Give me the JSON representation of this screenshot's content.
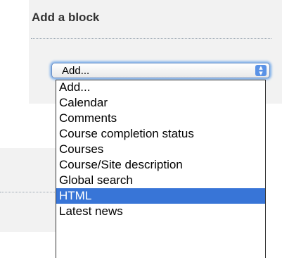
{
  "block": {
    "title": "Add a block"
  },
  "select": {
    "value": "Add...",
    "arrow_icon": "updown-arrows-icon",
    "accent": "#5a92e6"
  },
  "dropdown": {
    "selected_index": 7,
    "highlight_color": "#3875d7",
    "items": [
      "Add...",
      "Calendar",
      "Comments",
      "Course completion status",
      "Courses",
      "Course/Site description",
      "Global search",
      "HTML",
      "Latest news"
    ]
  }
}
